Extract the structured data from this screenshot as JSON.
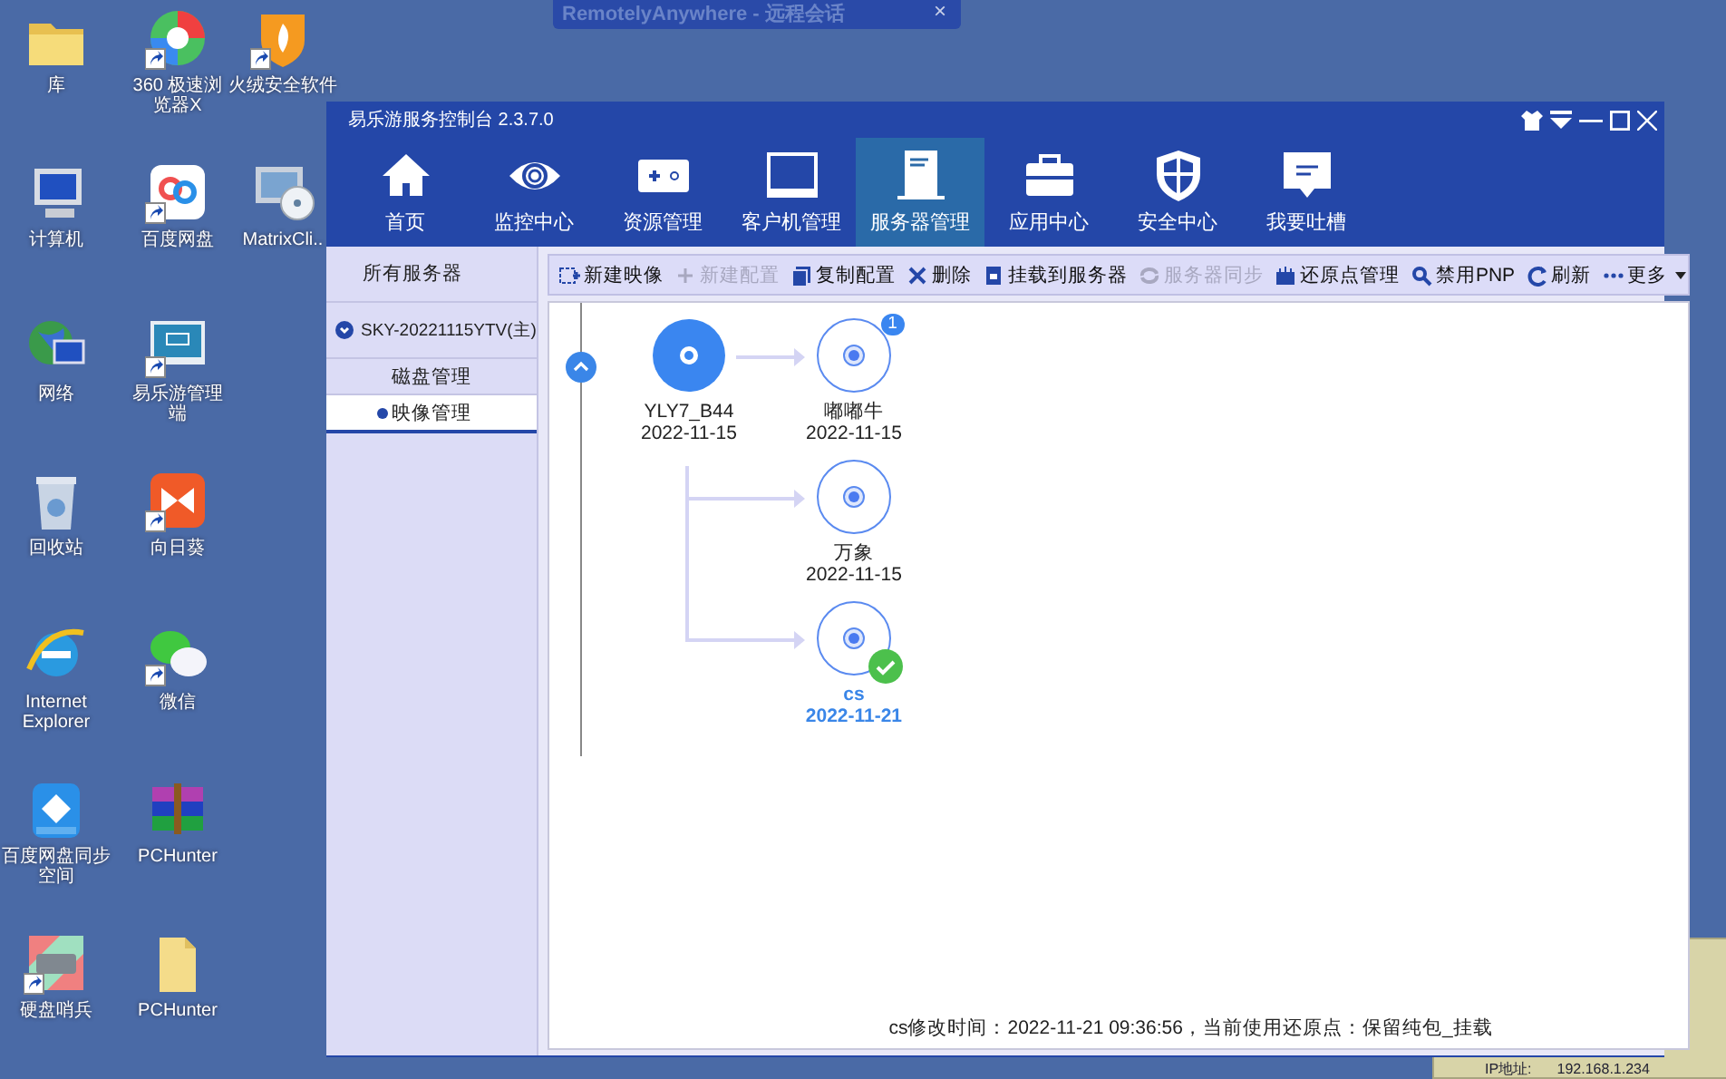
{
  "desktop_icons": [
    {
      "label": "库",
      "shortcut": false
    },
    {
      "label": "计算机",
      "shortcut": false
    },
    {
      "label": "网络",
      "shortcut": false
    },
    {
      "label": "回收站",
      "shortcut": false
    },
    {
      "label": "Internet Explorer",
      "shortcut": false
    },
    {
      "label": "百度网盘同步空间",
      "shortcut": false
    },
    {
      "label": "硬盘哨兵",
      "shortcut": true
    },
    {
      "label": "360 极速浏览器X",
      "shortcut": true
    },
    {
      "label": "百度网盘",
      "shortcut": true
    },
    {
      "label": "易乐游管理端",
      "shortcut": true
    },
    {
      "label": "向日葵",
      "shortcut": true
    },
    {
      "label": "微信",
      "shortcut": true
    },
    {
      "label": "PCHunter",
      "shortcut": false
    },
    {
      "label": "PCHunter",
      "shortcut": false
    },
    {
      "label": "火绒安全软件",
      "shortcut": true
    },
    {
      "label": "MatrixCli..",
      "shortcut": false
    }
  ],
  "remote_bar": {
    "title": "RemotelyAnywhere - 远程会话",
    "close": "×"
  },
  "back_window": {
    "label": "IP地址:",
    "value": "192.168.1.234"
  },
  "window": {
    "title": "易乐游服务控制台 2.3.7.0",
    "nav": [
      {
        "label": "首页",
        "selected": false
      },
      {
        "label": "监控中心",
        "selected": false
      },
      {
        "label": "资源管理",
        "selected": false
      },
      {
        "label": "客户机管理",
        "selected": false
      },
      {
        "label": "服务器管理",
        "selected": true
      },
      {
        "label": "应用中心",
        "selected": false
      },
      {
        "label": "安全中心",
        "selected": false
      },
      {
        "label": "我要吐槽",
        "selected": false
      }
    ],
    "sidebar": {
      "header": "所有服务器",
      "server": {
        "label": "SKY-20221115YTV(主)",
        "expanded": true,
        "children": [
          {
            "label": "磁盘管理",
            "selected": false
          },
          {
            "label": "映像管理",
            "selected": true
          }
        ]
      }
    },
    "toolbar": [
      {
        "label": "新建映像",
        "disabled": false
      },
      {
        "label": "新建配置",
        "disabled": true
      },
      {
        "label": "复制配置",
        "disabled": false
      },
      {
        "label": "删除",
        "disabled": false
      },
      {
        "label": "挂载到服务器",
        "disabled": false
      },
      {
        "label": "服务器同步",
        "disabled": true
      },
      {
        "label": "还原点管理",
        "disabled": false
      },
      {
        "label": "禁用PNP",
        "disabled": false
      },
      {
        "label": "刷新",
        "disabled": false
      },
      {
        "label": "更多",
        "disabled": false
      }
    ],
    "tree": {
      "root": {
        "name": "YLY7_B44",
        "date": "2022-11-15"
      },
      "children": [
        {
          "name": "嘟嘟牛",
          "date": "2022-11-15",
          "badge": "1",
          "active": false
        },
        {
          "name": "万象",
          "date": "2022-11-15",
          "active": false
        },
        {
          "name": "cs",
          "date": "2022-11-21",
          "active": true
        }
      ]
    },
    "status": "cs修改时间：2022-11-21 09:36:56，当前使用还原点：保留纯包_挂载"
  }
}
